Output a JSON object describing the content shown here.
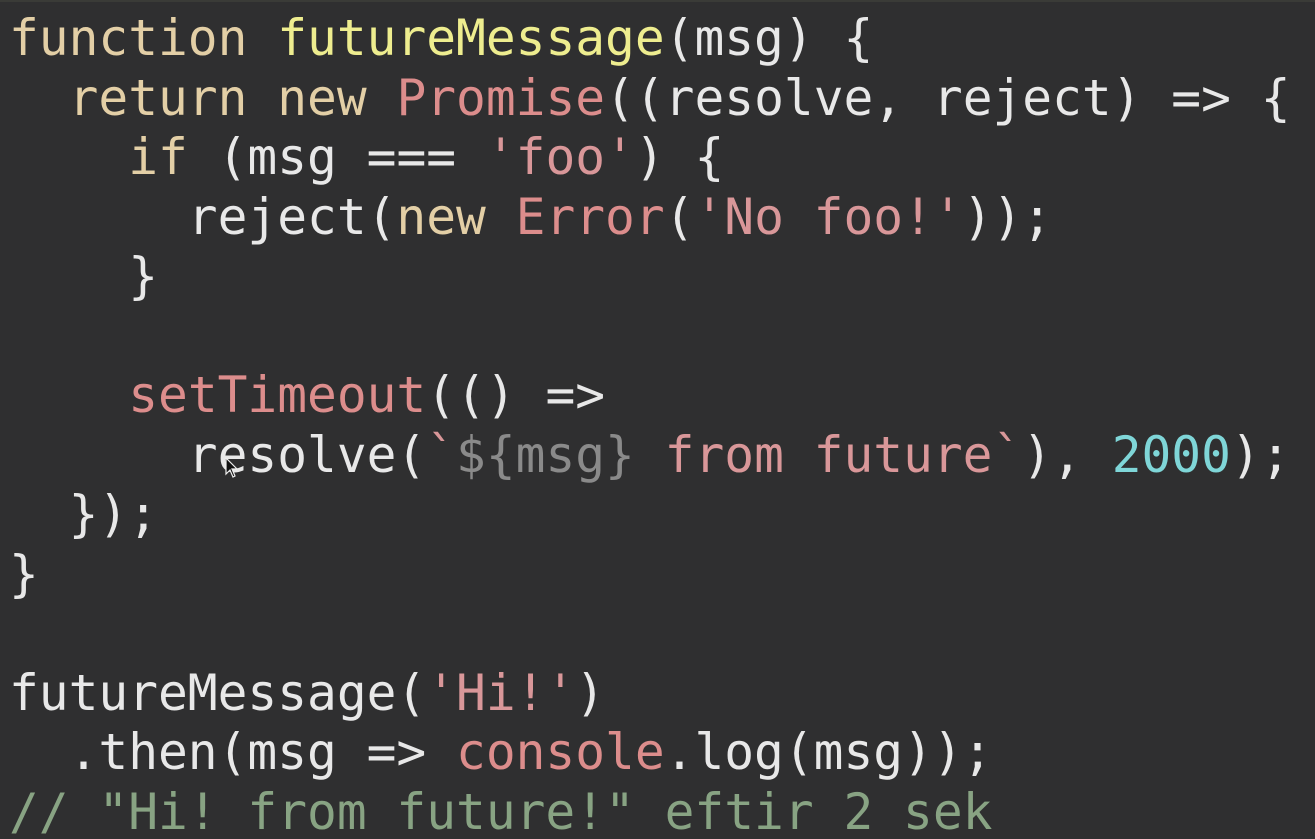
{
  "editor": {
    "lines": [
      [
        {
          "t": "kw",
          "v": "function"
        },
        {
          "t": "pun",
          "v": " "
        },
        {
          "t": "fn",
          "v": "futureMessage"
        },
        {
          "t": "pun",
          "v": "(msg) {"
        }
      ],
      [
        {
          "t": "pun",
          "v": "  "
        },
        {
          "t": "kw",
          "v": "return"
        },
        {
          "t": "pun",
          "v": " "
        },
        {
          "t": "kw",
          "v": "new"
        },
        {
          "t": "pun",
          "v": " "
        },
        {
          "t": "cls",
          "v": "Promise"
        },
        {
          "t": "pun",
          "v": "((resolve, reject) => {"
        }
      ],
      [
        {
          "t": "pun",
          "v": "    "
        },
        {
          "t": "kw",
          "v": "if"
        },
        {
          "t": "pun",
          "v": " (msg === "
        },
        {
          "t": "str",
          "v": "'foo'"
        },
        {
          "t": "pun",
          "v": ") {"
        }
      ],
      [
        {
          "t": "pun",
          "v": "      reject("
        },
        {
          "t": "kw",
          "v": "new"
        },
        {
          "t": "pun",
          "v": " "
        },
        {
          "t": "cls",
          "v": "Error"
        },
        {
          "t": "pun",
          "v": "("
        },
        {
          "t": "str",
          "v": "'No foo!'"
        },
        {
          "t": "pun",
          "v": "));"
        }
      ],
      [
        {
          "t": "pun",
          "v": "    }"
        }
      ],
      [],
      [
        {
          "t": "pun",
          "v": "    "
        },
        {
          "t": "cls",
          "v": "setTimeout"
        },
        {
          "t": "pun",
          "v": "(() =>"
        }
      ],
      [
        {
          "t": "pun",
          "v": "      resolve("
        },
        {
          "t": "str",
          "v": "`"
        },
        {
          "t": "tpl",
          "v": "${msg}"
        },
        {
          "t": "str",
          "v": " from future`"
        },
        {
          "t": "pun",
          "v": "), "
        },
        {
          "t": "num",
          "v": "2000"
        },
        {
          "t": "pun",
          "v": ");"
        }
      ],
      [
        {
          "t": "pun",
          "v": "  });"
        }
      ],
      [
        {
          "t": "pun",
          "v": "}"
        }
      ],
      [],
      [
        {
          "t": "pun",
          "v": "futureMessage("
        },
        {
          "t": "str",
          "v": "'Hi!'"
        },
        {
          "t": "pun",
          "v": ")"
        }
      ],
      [
        {
          "t": "pun",
          "v": "  .then(msg => "
        },
        {
          "t": "cls",
          "v": "console"
        },
        {
          "t": "pun",
          "v": ".log(msg));"
        }
      ],
      [
        {
          "t": "cmt",
          "v": "// \"Hi! from future!\" eftir 2 sek"
        }
      ]
    ]
  },
  "colors": {
    "background": "#2f2f30",
    "keyword": "#e3cfa6",
    "function_name": "#eeed8f",
    "class_name": "#dc8d8c",
    "string": "#d99799",
    "template_interpolation": "#8a8a8a",
    "number": "#7fd6d8",
    "comment": "#88a383",
    "plain": "#e8e8e8"
  },
  "cursor": {
    "icon": "mouse-pointer-icon"
  }
}
